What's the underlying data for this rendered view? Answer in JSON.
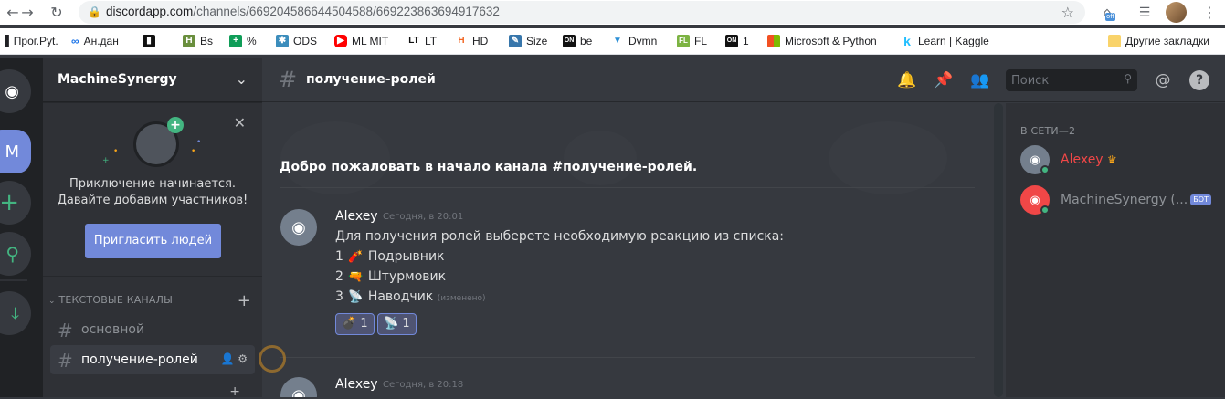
{
  "browser": {
    "url_host": "discordapp.com",
    "url_path": "/channels/669204586644504588/669223863694917632",
    "ext_badge": "off",
    "bookmarks": [
      {
        "label": "Прог.Pyt.",
        "icon": "folder-icon",
        "color": "#1a73e8"
      },
      {
        "label": "Ан.дан",
        "icon": "infinity-icon",
        "color": "#1a73e8"
      },
      {
        "label": "",
        "icon": "trello-icon",
        "color": "#111111"
      },
      {
        "label": "Bs",
        "icon": "bs-icon",
        "color": "#6a8f3e"
      },
      {
        "label": "%",
        "icon": "percent-icon",
        "color": "#0f9d58"
      },
      {
        "label": "ODS",
        "icon": "ods-icon",
        "color": "#3c8dbc"
      },
      {
        "label": "ML MIT",
        "icon": "youtube-icon",
        "color": "#ff0000"
      },
      {
        "label": "LT",
        "icon": "lt-icon",
        "color": "#111111"
      },
      {
        "label": "HD",
        "icon": "hd-icon",
        "color": "#f26522"
      },
      {
        "label": "Size",
        "icon": "python-icon",
        "color": "#3776ab"
      },
      {
        "label": "be",
        "icon": "on-icon",
        "color": "#111111"
      },
      {
        "label": "Dvmn",
        "icon": "dvmn-icon",
        "color": "#2c8fd6"
      },
      {
        "label": "FL",
        "icon": "fl-icon",
        "color": "#7cb342"
      },
      {
        "label": "1",
        "icon": "on-icon",
        "color": "#111111"
      },
      {
        "label": "Microsoft & Python",
        "icon": "microsoft-icon",
        "color": "#f25022"
      },
      {
        "label": "Learn | Kaggle",
        "icon": "kaggle-icon",
        "color": "#20beff"
      }
    ],
    "other_bookmarks": "Другие закладки"
  },
  "server": {
    "name": "MachineSynergy",
    "guild_letter": "M"
  },
  "invite": {
    "line1": "Приключение начинается.",
    "line2": "Давайте добавим участников!",
    "button": "Пригласить людей"
  },
  "sidebar": {
    "category": "ТЕКСТОВЫЕ КАНАЛЫ",
    "channels": [
      {
        "name": "основной"
      },
      {
        "name": "получение-ролей"
      }
    ]
  },
  "chat": {
    "channel": "получение-ролей",
    "search_placeholder": "Поиск",
    "welcome": "Добро пожаловать в начало канала #получение-ролей.",
    "messages": [
      {
        "author": "Alexey",
        "time": "Сегодня, в 20:01",
        "lines": [
          "Для получения ролей выберете необходимую реакцию из списка:",
          "1",
          "Подрывник",
          "2",
          "Штурмовик",
          "3",
          "Наводчик",
          "(изменено)"
        ],
        "reactions": [
          {
            "emoji": "💣",
            "count": "1"
          },
          {
            "emoji": "📡",
            "count": "1"
          }
        ]
      },
      {
        "author": "Alexey",
        "time": "Сегодня, в 20:18"
      }
    ]
  },
  "members": {
    "heading": "В СЕТИ—2",
    "list": [
      {
        "name": "Alexey",
        "role_color": "#f04747",
        "crown": "♛"
      },
      {
        "name": "MachineSynergy (...",
        "bot": "БОТ"
      }
    ]
  },
  "colors": {
    "blurple": "#7289da",
    "green": "#43b581",
    "red": "#f04747"
  }
}
